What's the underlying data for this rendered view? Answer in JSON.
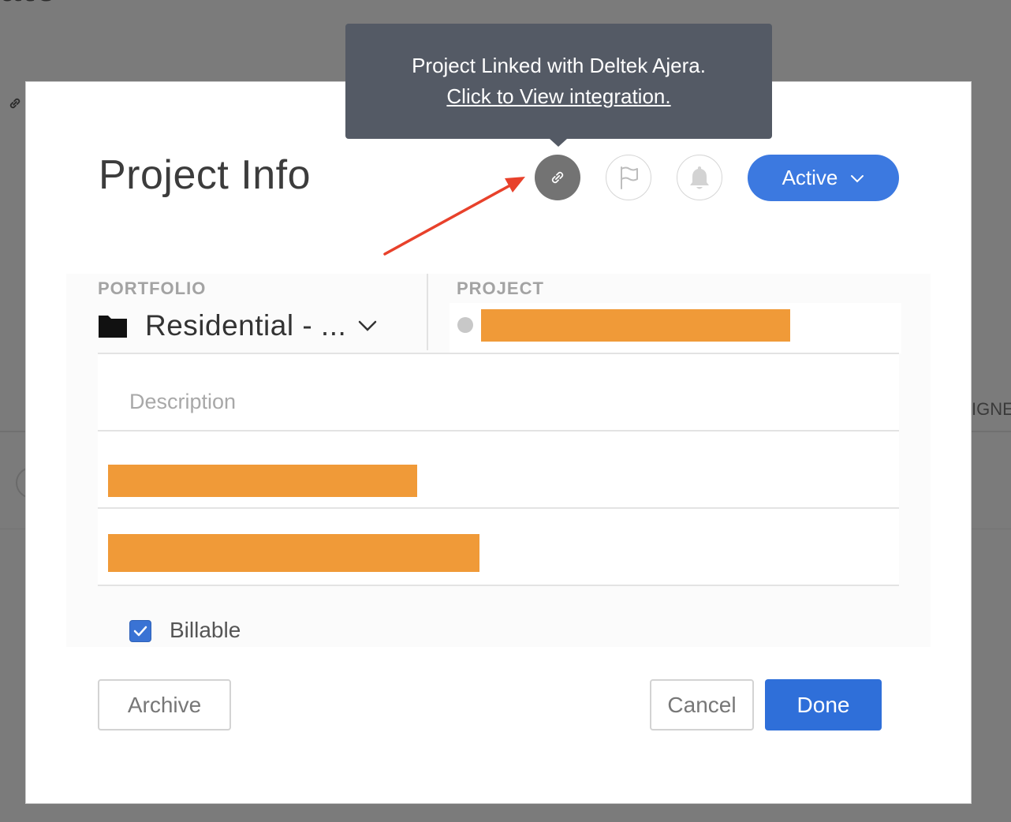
{
  "background": {
    "title_fragment": "ate",
    "right_fragment": "IGNE"
  },
  "modal": {
    "title": "Project Info",
    "status_label": "Active",
    "icons": [
      "link-icon",
      "flag-icon",
      "bell-icon",
      "chevron-down-icon",
      "folder-icon"
    ]
  },
  "tooltip": {
    "line1": "Project Linked with Deltek Ajera.",
    "link_text": "Click to View integration."
  },
  "form": {
    "portfolio_label": "PORTFOLIO",
    "portfolio_value": "Residential - ...",
    "project_label": "PROJECT",
    "description_placeholder": "Description",
    "billable_label": "Billable",
    "billable_checked": true
  },
  "buttons": {
    "archive": "Archive",
    "cancel": "Cancel",
    "done": "Done"
  },
  "colors": {
    "accent": "#3c79e0",
    "redaction": "#f09a38",
    "annotation_arrow": "#e8412b",
    "tooltip_bg": "#545a65"
  }
}
